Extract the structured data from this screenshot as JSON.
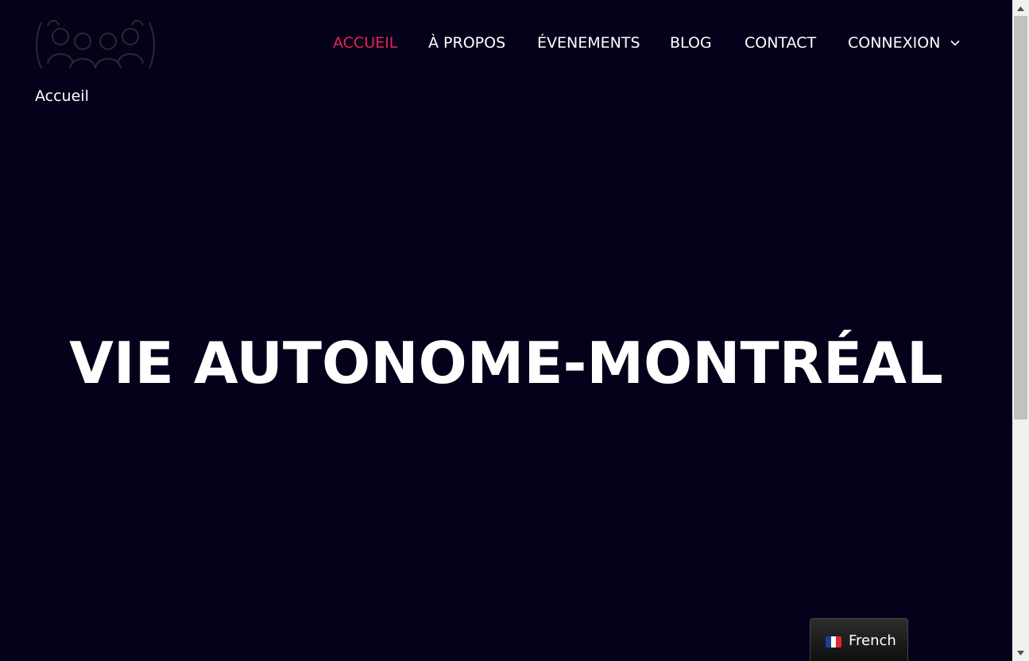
{
  "header": {
    "breadcrumb": "Accueil",
    "nav": {
      "accueil": "ACCUEIL",
      "a_propos": "À PROPOS",
      "evenements": "ÉVENEMENTS",
      "blog": "BLOG",
      "contact": "CONTACT",
      "connexion": "CONNEXION"
    },
    "active_item": "accueil"
  },
  "hero": {
    "title": "VIE AUTONOME-MONTRÉAL"
  },
  "language_switcher": {
    "label": "French",
    "flag_icon": "france-flag-icon"
  },
  "colors": {
    "background": "#03021a",
    "accent": "#e5254d",
    "text": "#ffffff"
  }
}
